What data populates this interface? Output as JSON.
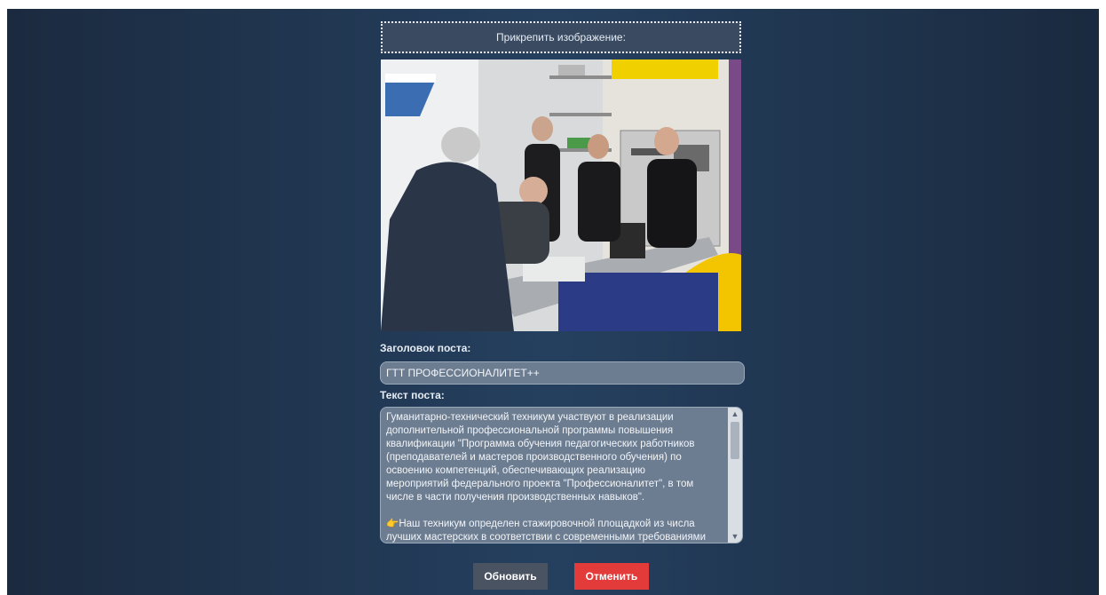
{
  "form": {
    "attach_label": "Прикрепить изображение:",
    "title_label": "Заголовок поста:",
    "title_value": "ГТТ ПРОФЕССИОНАЛИТЕТ++",
    "text_label": "Текст поста:",
    "text_value": "Гуманитарно-технический техникум участвуют в реализации дополнительной профессиональной программы повышения квалификации \"Программа обучения педагогических работников (преподавателей и мастеров производственного обучения) по освоению компетенций, обеспечивающих реализацию мероприятий федерального проекта \"Профессионалитет\", в том числе в части получения производственных навыков\".\n\n👉Наш техникум определен стажировочной площадкой из числа лучших мастерских в соответствии с современными требованиями к"
  },
  "buttons": {
    "update_label": "Обновить",
    "cancel_label": "Отменить"
  },
  "colors": {
    "background": "#1f334d",
    "cancel": "#e33a3a",
    "update": "#4a5361"
  },
  "icons": {
    "scroll_up": "chevron-up-icon",
    "scroll_down": "chevron-down-icon"
  }
}
